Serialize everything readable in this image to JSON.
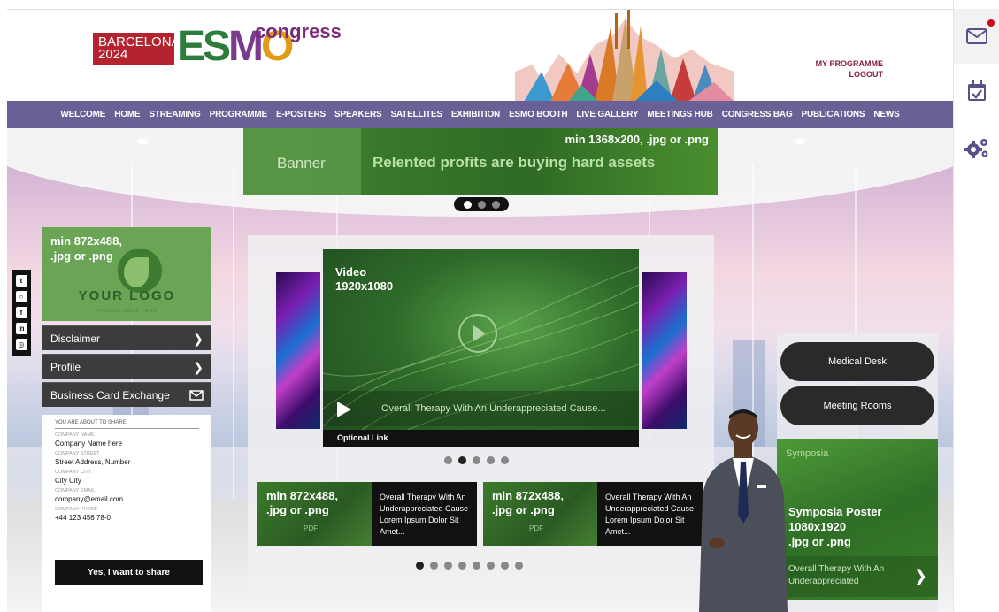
{
  "header": {
    "logo_city": "BARCELONA",
    "logo_year": "2024",
    "logo_e": "E",
    "logo_s": "S",
    "logo_m": "M",
    "logo_o": "O",
    "logo_congress": "congress",
    "my_programme": "MY PROGRAMME",
    "logout": "LOGOUT"
  },
  "nav": {
    "items": [
      "WELCOME",
      "HOME",
      "STREAMING",
      "PROGRAMME",
      "E-POSTERS",
      "SPEAKERS",
      "SATELLITES",
      "EXHIBITION",
      "ESMO BOOTH",
      "LIVE GALLERY",
      "MEETINGS HUB",
      "CONGRESS BAG",
      "PUBLICATIONS",
      "NEWS"
    ]
  },
  "rail": {
    "icons": [
      "envelope-icon",
      "calendar-check-icon",
      "gears-icon"
    ],
    "notification_color": "#d0021b"
  },
  "banner": {
    "label": "Banner",
    "size": "min 1368x200, .jpg or .png",
    "slogan": "Relented profits are buying hard assets",
    "carousel_dots": 3,
    "active_dot": 0
  },
  "left_panel": {
    "logo_size": "min 872x488,",
    "logo_format": ".jpg or .png",
    "logo_text": "YOUR LOGO",
    "tagline": "TAGLINE GOES HERE",
    "menu": {
      "disclaimer": "Disclaimer",
      "profile": "Profile",
      "business_card": "Business Card Exchange"
    },
    "form": {
      "header": "YOU ARE ABOUT TO SHARE:",
      "company_name_label": "COMPANY NAME",
      "company_name": "Company Name here",
      "company_street_label": "COMPANY STREET",
      "company_street": "Street Address, Number",
      "company_city_label": "COMPANY CITY",
      "company_city": "City City",
      "company_email_label": "COMPANY EMAIL",
      "company_email": "company@email.com",
      "company_phone_label": "COMPANY PHONE",
      "company_phone": "+44 123 456 78-0",
      "share_button": "Yes, I want to share"
    }
  },
  "social": {
    "icons": [
      "twitter-icon",
      "instagram-icon",
      "facebook-icon",
      "linkedin-icon",
      "globe-icon"
    ]
  },
  "video": {
    "label": "Video",
    "resolution": "1920x1080",
    "title": "Overall Therapy With An Underappreciated Cause...",
    "optional_link": "Optional Link",
    "carousel_dots": 5,
    "active_dot": 1
  },
  "pdf_cards": [
    {
      "size": "min 872x488,",
      "format": ".jpg or .png",
      "type": "PDF",
      "text": "Overall Therapy With An Underappreciated Cause Lorem Ipsum Dolor Sit Amet..."
    },
    {
      "size": "min 872x488,",
      "format": ".jpg or .png",
      "type": "PDF",
      "text": "Overall Therapy With An Underappreciated Cause Lorem Ipsum Dolor Sit Amet..."
    }
  ],
  "pdf_carousel": {
    "dots": 8,
    "active_dot": 0
  },
  "right_panel": {
    "medical_desk": "Medical Desk",
    "meeting_rooms": "Meeting Rooms",
    "symposia_label": "Symposia",
    "symposia_poster": "Symposia Poster",
    "symposia_size": "1080x1920",
    "symposia_format": ".jpg or .png",
    "symposia_caption": "Overall Therapy With An Underappreciated"
  },
  "colors": {
    "nav": "#6b6096",
    "banner_green": "#3a7a2c",
    "accent_red": "#b5232f",
    "link": "#8a1c3c"
  }
}
